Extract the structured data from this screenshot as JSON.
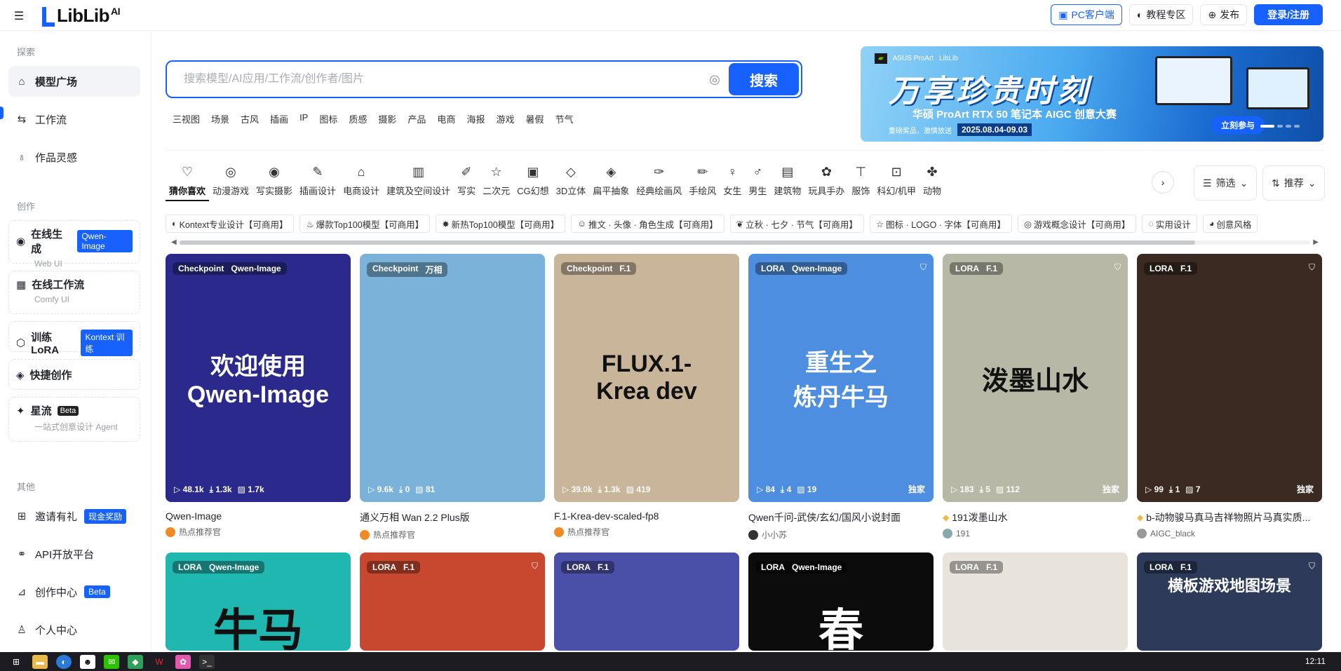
{
  "header": {
    "logo": "LibLib",
    "logo_suffix": "AI",
    "pc_client": "PC客户端",
    "tutorial": "教程专区",
    "publish": "发布",
    "login": "登录/注册"
  },
  "sidebar": {
    "section_explore": "探索",
    "explore_items": [
      {
        "label": "模型广场",
        "icon": "home-icon"
      },
      {
        "label": "工作流",
        "icon": "workflow-icon"
      },
      {
        "label": "作品灵感",
        "icon": "bulb-icon"
      }
    ],
    "section_create": "创作",
    "create_cards": [
      {
        "label": "在线生成",
        "tag": "Qwen-Image",
        "sub": "Web UI"
      },
      {
        "label": "在线工作流",
        "tag": "",
        "sub": "Comfy UI"
      },
      {
        "label": "训练LoRA",
        "tag": "Kontext 训练",
        "sub": ""
      },
      {
        "label": "快捷创作",
        "tag": "",
        "sub": ""
      },
      {
        "label": "星流",
        "tag": "Beta",
        "sub": "一站式创意设计 Agent"
      }
    ],
    "section_other": "其他",
    "other_items": [
      {
        "label": "邀请有礼",
        "tag": "现金奖励"
      },
      {
        "label": "API开放平台",
        "tag": ""
      },
      {
        "label": "创作中心",
        "tag": "Beta"
      },
      {
        "label": "个人中心",
        "tag": ""
      }
    ]
  },
  "search": {
    "placeholder": "搜索模型/AI应用/工作流/创作者/图片",
    "button": "搜索",
    "hot_words": [
      "三视图",
      "场景",
      "古风",
      "插画",
      "IP",
      "图标",
      "质感",
      "摄影",
      "产品",
      "电商",
      "海报",
      "游戏",
      "暑假",
      "节气"
    ]
  },
  "banner": {
    "brand": "ASUS ProArt",
    "brand2": "LibLib",
    "headline": "万享珍贵时刻",
    "subline": "华硕 ProArt RTX 50 笔记本 AIGC 创意大赛",
    "note": "重磅奖品，激情放送",
    "date": "2025.08.04-09.03",
    "cta": "立刻参与"
  },
  "categories": [
    {
      "label": "猜你喜欢",
      "icon": "heart-icon",
      "glyph": "♡"
    },
    {
      "label": "动漫游戏",
      "icon": "gamepad-icon",
      "glyph": "◎"
    },
    {
      "label": "写实摄影",
      "icon": "camera-icon",
      "glyph": "◉"
    },
    {
      "label": "插画设计",
      "icon": "palette-icon",
      "glyph": "✎"
    },
    {
      "label": "电商设计",
      "icon": "bag-icon",
      "glyph": "⌂"
    },
    {
      "label": "建筑及空间设计",
      "icon": "building-icon",
      "glyph": "▥"
    },
    {
      "label": "写实",
      "icon": "pen-icon",
      "glyph": "✐"
    },
    {
      "label": "二次元",
      "icon": "star-icon",
      "glyph": "☆"
    },
    {
      "label": "CG幻想",
      "icon": "cg-icon",
      "glyph": "▣"
    },
    {
      "label": "3D立体",
      "icon": "cube-icon",
      "glyph": "◇"
    },
    {
      "label": "扁平抽象",
      "icon": "layers-icon",
      "glyph": "◈"
    },
    {
      "label": "经典绘画风",
      "icon": "brush-icon",
      "glyph": "✑"
    },
    {
      "label": "手绘风",
      "icon": "pencil-icon",
      "glyph": "✏"
    },
    {
      "label": "女生",
      "icon": "female-icon",
      "glyph": "♀"
    },
    {
      "label": "男生",
      "icon": "male-icon",
      "glyph": "♂"
    },
    {
      "label": "建筑物",
      "icon": "house-icon",
      "glyph": "▤"
    },
    {
      "label": "玩具手办",
      "icon": "toy-icon",
      "glyph": "✿"
    },
    {
      "label": "服饰",
      "icon": "shirt-icon",
      "glyph": "⊤"
    },
    {
      "label": "科幻/机甲",
      "icon": "robot-icon",
      "glyph": "⊡"
    },
    {
      "label": "动物",
      "icon": "paw-icon",
      "glyph": "✤"
    }
  ],
  "filter_label": "筛选",
  "sort_label": "推荐",
  "chips": [
    {
      "label": "Kontext专业设计【可商用】",
      "glyph": "◐"
    },
    {
      "label": "爆款Top100模型【可商用】",
      "glyph": "♨"
    },
    {
      "label": "新热Top100模型【可商用】",
      "glyph": "✸"
    },
    {
      "label": "推文 · 头像 · 角色生成【可商用】",
      "glyph": "☺"
    },
    {
      "label": "立秋 · 七夕 · 节气【可商用】",
      "glyph": "❦"
    },
    {
      "label": "图标 · LOGO · 字体【可商用】",
      "glyph": "☆"
    },
    {
      "label": "游戏概念设计【可商用】",
      "glyph": "◎"
    },
    {
      "label": "实用设计",
      "glyph": "◌"
    },
    {
      "label": "创意风格",
      "glyph": "◕"
    }
  ],
  "cards": [
    {
      "type": "Checkpoint",
      "base": "Qwen-Image",
      "art": "欢迎使用\nQwen-Image",
      "runs": "48.1k",
      "downloads": "1.3k",
      "images": "1.7k",
      "exclusive": "",
      "title": "Qwen-Image",
      "author": "热点推荐官",
      "bg": "#2b2a8c",
      "fg": "#ffffff"
    },
    {
      "type": "Checkpoint",
      "base": "万相",
      "art": "",
      "runs": "9.6k",
      "downloads": "0",
      "images": "81",
      "exclusive": "",
      "title": "通义万相 Wan 2.2 Plus版",
      "author": "热点推荐官",
      "bg": "#7ab2d9",
      "fg": "#ffffff"
    },
    {
      "type": "Checkpoint",
      "base": "F.1",
      "art": "FLUX.1-\nKrea dev",
      "runs": "39.0k",
      "downloads": "1.3k",
      "images": "419",
      "exclusive": "",
      "title": "F.1-Krea-dev-scaled-fp8",
      "author": "热点推荐官",
      "bg": "#c9b59a",
      "fg": "#111111"
    },
    {
      "type": "LORA",
      "base": "Qwen-Image",
      "art": "重生之\n炼丹牛马",
      "runs": "84",
      "downloads": "4",
      "images": "19",
      "exclusive": "独家",
      "title": "Qwen千问-武侠/玄幻/国风小说封面",
      "author": "小小苏",
      "bg": "#4d8ee0",
      "fg": "#ffffff"
    },
    {
      "type": "LORA",
      "base": "F.1",
      "art": "泼墨山水",
      "runs": "183",
      "downloads": "5",
      "images": "112",
      "exclusive": "独家",
      "title": "191泼墨山水",
      "author": "191",
      "bg": "#b7b9a6",
      "fg": "#111111"
    },
    {
      "type": "LORA",
      "base": "F.1",
      "art": "",
      "runs": "99",
      "downloads": "1",
      "images": "7",
      "exclusive": "独家",
      "title": "b-动物骏马真马吉祥物照片马真实质...",
      "author": "AIGC_black",
      "bg": "#3a2a22",
      "fg": "#ffffff"
    }
  ],
  "row2": [
    {
      "type": "LORA",
      "base": "Qwen-Image",
      "art": "牛马",
      "bg": "#1fb7b0",
      "fg": "#111111"
    },
    {
      "type": "LORA",
      "base": "F.1",
      "art": "",
      "bg": "#c7482f",
      "fg": "#ffffff"
    },
    {
      "type": "LORA",
      "base": "F.1",
      "art": "",
      "bg": "#4a4fa8",
      "fg": "#ffffff"
    },
    {
      "type": "LORA",
      "base": "Qwen-Image",
      "art": "春",
      "bg": "#0c0c0c",
      "fg": "#ffffff"
    },
    {
      "type": "LORA",
      "base": "F.1",
      "art": "",
      "bg": "#e8e4dc",
      "fg": "#111111"
    },
    {
      "type": "LORA",
      "base": "F.1",
      "art": "横板游戏地图场景",
      "bg": "#2d3a5a",
      "fg": "#ffffff"
    }
  ],
  "taskbar": {
    "time": "12:11"
  }
}
